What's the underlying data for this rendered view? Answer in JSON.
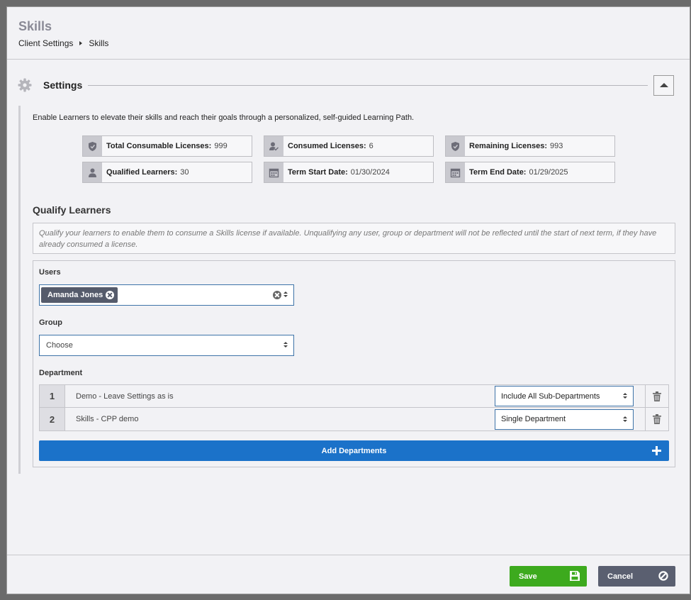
{
  "header": {
    "title": "Skills",
    "breadcrumb": [
      "Client Settings",
      "Skills"
    ]
  },
  "settings": {
    "title": "Settings",
    "description": "Enable Learners to elevate their skills and reach their goals through a personalized, self-guided Learning Path."
  },
  "licenses": [
    {
      "label": "Total Consumable Licenses:",
      "value": "999",
      "icon": "licenses-icon"
    },
    {
      "label": "Consumed Licenses:",
      "value": "6",
      "icon": "user-check-icon"
    },
    {
      "label": "Remaining Licenses:",
      "value": "993",
      "icon": "licenses-icon"
    },
    {
      "label": "Qualified Learners:",
      "value": "30",
      "icon": "user-icon"
    },
    {
      "label": "Term Start Date:",
      "value": "01/30/2024",
      "icon": "calendar-icon"
    },
    {
      "label": "Term End Date:",
      "value": "01/29/2025",
      "icon": "calendar-icon"
    }
  ],
  "qualify": {
    "title": "Qualify Learners",
    "note": "Qualify your learners to enable them to consume a Skills license if available. Unqualifying any user, group or department will not be reflected until the start of next term, if they have already consumed a license.",
    "users_label": "Users",
    "selected_user": "Amanda Jones",
    "group_label": "Group",
    "group_value": "Choose",
    "department_label": "Department",
    "departments": [
      {
        "num": "1",
        "name": "Demo - Leave Settings as is",
        "option": "Include All Sub-Departments"
      },
      {
        "num": "2",
        "name": "Skills - CPP demo",
        "option": "Single Department"
      }
    ],
    "add_departments_label": "Add Departments"
  },
  "footer": {
    "save_label": "Save",
    "cancel_label": "Cancel"
  },
  "colors": {
    "primary": "#1b72c9",
    "save": "#3daa1e",
    "cancel": "#5a5f70"
  }
}
